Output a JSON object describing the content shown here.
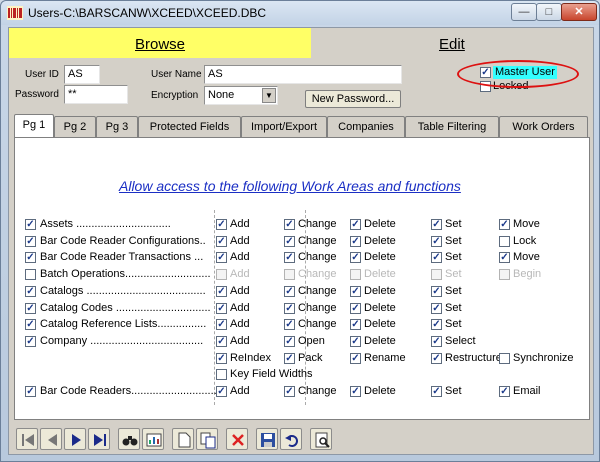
{
  "window": {
    "title": "Users-C:\\BARSCANW\\XCEED\\XCEED.DBC",
    "controls": {
      "minimize": "—",
      "maximize": "□",
      "close": "✕"
    }
  },
  "header": {
    "browse_label": "Browse",
    "edit_label": "Edit"
  },
  "form": {
    "user_id_label": "User ID",
    "user_id_value": "AS",
    "user_name_label": "User Name",
    "user_name_value": "AS",
    "password_label": "Password",
    "password_value": "**",
    "encryption_label": "Encryption",
    "encryption_value": "None",
    "new_password_button": "New Password...",
    "master_user_label": "Master User",
    "master_user_checked": true,
    "locked_label": "Locked",
    "locked_checked": false
  },
  "tabs": [
    {
      "label": "Pg 1",
      "active": true
    },
    {
      "label": "Pg 2",
      "active": false
    },
    {
      "label": "Pg 3",
      "active": false
    },
    {
      "label": "Protected Fields",
      "active": false
    },
    {
      "label": "Import/Export",
      "active": false
    },
    {
      "label": "Companies",
      "active": false
    },
    {
      "label": "Table Filtering",
      "active": false
    },
    {
      "label": "Work Orders",
      "active": false
    }
  ],
  "section_title": "Allow access to the following Work Areas and functions",
  "rows": [
    {
      "label": "Assets ...............................",
      "checked": true,
      "options": [
        [
          "Add",
          true,
          false
        ],
        [
          "Change",
          true,
          false
        ],
        [
          "Delete",
          true,
          false
        ],
        [
          "Set",
          true,
          false
        ],
        [
          "Move",
          true,
          false
        ]
      ]
    },
    {
      "label": "Bar Code Reader Configurations..",
      "checked": true,
      "options": [
        [
          "Add",
          true,
          false
        ],
        [
          "Change",
          true,
          false
        ],
        [
          "Delete",
          true,
          false
        ],
        [
          "Set",
          true,
          false
        ],
        [
          "Lock",
          false,
          false
        ]
      ]
    },
    {
      "label": "Bar Code Reader Transactions ...",
      "checked": true,
      "options": [
        [
          "Add",
          true,
          false
        ],
        [
          "Change",
          true,
          false
        ],
        [
          "Delete",
          true,
          false
        ],
        [
          "Set",
          true,
          false
        ],
        [
          "Move",
          true,
          false
        ]
      ]
    },
    {
      "label": "Batch Operations............................",
      "checked": false,
      "options": [
        [
          "Add",
          false,
          true
        ],
        [
          "Change",
          false,
          true
        ],
        [
          "Delete",
          false,
          true
        ],
        [
          "Set",
          false,
          true
        ],
        [
          "Begin",
          false,
          true
        ]
      ]
    },
    {
      "label": "Catalogs .......................................",
      "checked": true,
      "options": [
        [
          "Add",
          true,
          false
        ],
        [
          "Change",
          true,
          false
        ],
        [
          "Delete",
          true,
          false
        ],
        [
          "Set",
          true,
          false
        ]
      ]
    },
    {
      "label": "Catalog Codes ...............................",
      "checked": true,
      "options": [
        [
          "Add",
          true,
          false
        ],
        [
          "Change",
          true,
          false
        ],
        [
          "Delete",
          true,
          false
        ],
        [
          "Set",
          true,
          false
        ]
      ]
    },
    {
      "label": "Catalog Reference Lists................",
      "checked": true,
      "options": [
        [
          "Add",
          true,
          false
        ],
        [
          "Change",
          true,
          false
        ],
        [
          "Delete",
          true,
          false
        ],
        [
          "Set",
          true,
          false
        ]
      ]
    },
    {
      "label": "Company .....................................",
      "checked": true,
      "options": [
        [
          "Add",
          true,
          false
        ],
        [
          "Open",
          true,
          false
        ],
        [
          "Delete",
          true,
          false
        ],
        [
          "Select",
          true,
          false
        ]
      ]
    },
    {
      "label": "",
      "checked": null,
      "options": [
        [
          "ReIndex",
          true,
          false
        ],
        [
          "Pack",
          true,
          false
        ],
        [
          "Rename",
          true,
          false
        ],
        [
          "Restructure",
          true,
          false
        ],
        [
          "Synchronize",
          false,
          false
        ]
      ]
    },
    {
      "label": "",
      "checked": null,
      "options": [
        [
          "Key Field Widths",
          false,
          false
        ]
      ]
    },
    {
      "label": "Bar Code Readers...............................",
      "checked": true,
      "options": [
        [
          "Add",
          true,
          false
        ],
        [
          "Change",
          true,
          false
        ],
        [
          "Delete",
          true,
          false
        ],
        [
          "Set",
          true,
          false
        ],
        [
          "Email",
          true,
          false
        ]
      ]
    }
  ],
  "toolbar": [
    {
      "name": "first-record-icon"
    },
    {
      "name": "previous-record-icon"
    },
    {
      "name": "next-record-icon"
    },
    {
      "name": "last-record-icon"
    },
    {
      "name": "binoculars-icon"
    },
    {
      "name": "report-icon"
    },
    {
      "name": "new-document-icon"
    },
    {
      "name": "copy-document-icon"
    },
    {
      "name": "delete-icon"
    },
    {
      "name": "save-icon"
    },
    {
      "name": "undo-icon"
    },
    {
      "name": "preview-icon"
    }
  ],
  "colors": {
    "browse_bg": "#ffff66",
    "master_highlight": "#33ffff",
    "section_title": "#1b2fc4",
    "annotation_ellipse": "#dd1111"
  }
}
